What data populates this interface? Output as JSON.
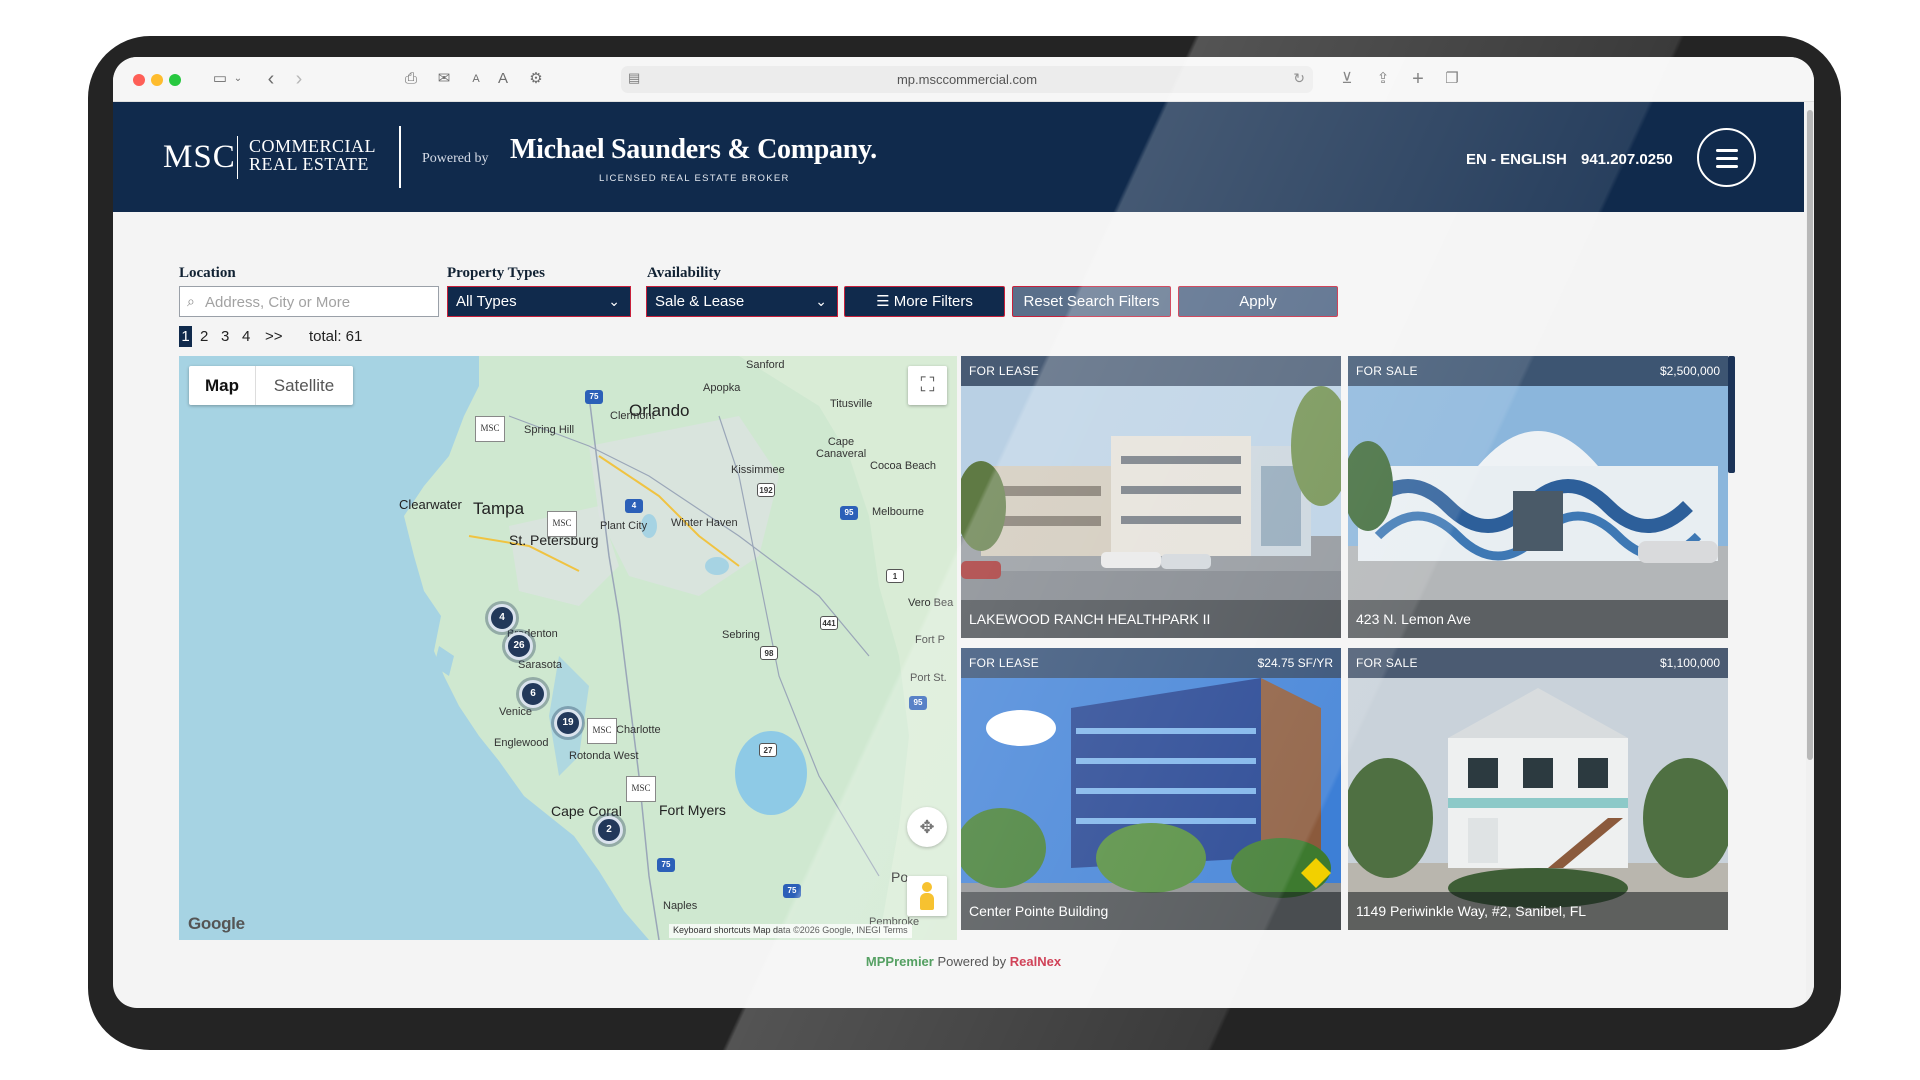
{
  "browser": {
    "url": "mp.msccommercial.com"
  },
  "header": {
    "logo_msc": "MSC",
    "logo_line1": "COMMERCIAL",
    "logo_line2": "REAL ESTATE",
    "powered_by": "Powered by",
    "company_name": "Michael Saunders & Company.",
    "company_sub": "LICENSED REAL ESTATE BROKER",
    "language": "EN - ENGLISH",
    "phone": "941.207.0250"
  },
  "filters": {
    "location_label": "Location",
    "location_placeholder": "Address, City or More",
    "location_value": "",
    "property_types_label": "Property Types",
    "property_types_value": "All Types",
    "availability_label": "Availability",
    "availability_value": "Sale & Lease",
    "more_filters": "More Filters",
    "reset": "Reset Search Filters",
    "apply": "Apply"
  },
  "pagination": {
    "pages": [
      "1",
      "2",
      "3",
      "4"
    ],
    "next": ">>",
    "total": "total: 61"
  },
  "map": {
    "toggle_map": "Map",
    "toggle_satellite": "Satellite",
    "google": "Google",
    "attribution": "Keyboard shortcuts   Map data ©2026 Google, INEGI   Terms",
    "cities": {
      "orlando": "Orlando",
      "tampa": "Tampa",
      "clearwater": "Clearwater",
      "st_petersburg": "St. Petersburg",
      "cape_coral": "Cape Coral",
      "fort_myers": "Fort Myers",
      "sanford": "Sanford",
      "apopka": "Apopka",
      "clermont": "Clermont",
      "titusville": "Titusville",
      "spring_hill": "Spring Hill",
      "cape_canaveral": "Cape\nCanaveral",
      "cocoa_beach": "Cocoa Beach",
      "kissimmee": "Kissimmee",
      "melbourne": "Melbourne",
      "plant_city": "Plant City",
      "winter_haven": "Winter Haven",
      "bradenton": "Bradenton",
      "sarasota": "Sarasota",
      "sebring": "Sebring",
      "venice": "Venice",
      "charlotte": "Charlotte",
      "englewood": "Englewood",
      "rotonda_west": "Rotonda West",
      "naples": "Naples",
      "vero_beach": "Vero Bea",
      "fort_pierce": "Fort P",
      "port_st": "Port St.",
      "pembroke": "Pembroke",
      "po": "Po"
    },
    "clusters": [
      "4",
      "26",
      "6",
      "19",
      "2"
    ],
    "msc_pin": "MSC",
    "shields": [
      "75",
      "4",
      "192",
      "95",
      "1",
      "441",
      "98",
      "95",
      "27",
      "75",
      "75"
    ]
  },
  "listings": [
    {
      "status": "FOR LEASE",
      "price": "",
      "title": "LAKEWOOD RANCH HEALTHPARK II"
    },
    {
      "status": "FOR SALE",
      "price": "$2,500,000",
      "title": "423 N. Lemon Ave"
    },
    {
      "status": "FOR LEASE",
      "price": "$24.75 SF/YR",
      "title": "Center Pointe Building"
    },
    {
      "status": "FOR SALE",
      "price": "$1,100,000",
      "title": "1149 Periwinkle Way, #2, Sanibel, FL"
    }
  ],
  "footer": {
    "mp": "MPPremier",
    "powered": "Powered by",
    "realnex": "RealNex"
  }
}
